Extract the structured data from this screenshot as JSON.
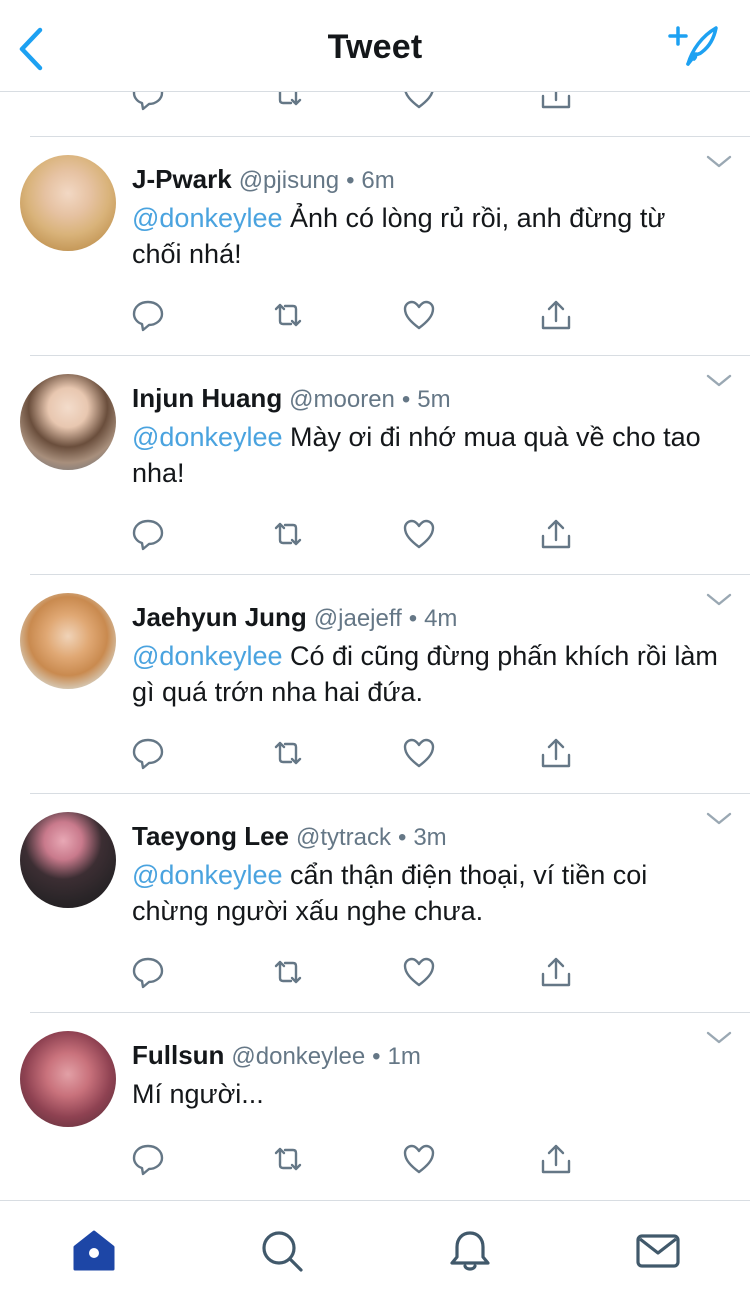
{
  "header": {
    "title": "Tweet"
  },
  "icons": {
    "back": "chevron-left-icon",
    "compose": "compose-sparkle-feather-icon",
    "reply": "reply-bubble-icon",
    "retweet": "retweet-icon",
    "like": "heart-icon",
    "share": "share-icon",
    "caret": "chevron-down-icon"
  },
  "colors": {
    "accent": "#1da1f2",
    "mention": "#4aa3df",
    "text": "#14171a",
    "muted": "#657786",
    "icon": "#657786",
    "tab_active": "#1d46a6",
    "tab_inactive": "#41596b"
  },
  "tweets": [
    {
      "name": "J-Pwark",
      "handle": "@pjisung",
      "time": "6m",
      "mention": "@donkeylee",
      "text": " Ảnh có lòng rủ rồi, anh đừng từ chối nhá!"
    },
    {
      "name": "Injun Huang",
      "handle": "@mooren",
      "time": "5m",
      "mention": "@donkeylee",
      "text": " Mày ơi đi nhớ mua quà về cho tao nha!"
    },
    {
      "name": "Jaehyun Jung",
      "handle": "@jaejeff",
      "time": "4m",
      "mention": "@donkeylee",
      "text": " Có đi cũng đừng phấn khích rồi làm gì quá trớn nha hai đứa."
    },
    {
      "name": "Taeyong Lee",
      "handle": "@tytrack",
      "time": "3m",
      "mention": "@donkeylee",
      "text": " cẩn thận điện thoại, ví tiền coi chừng người xấu nghe chưa."
    },
    {
      "name": "Fullsun",
      "handle": "@donkeylee",
      "time": "1m",
      "mention": "",
      "text": "Mí người..."
    }
  ],
  "separator": "•",
  "tabbar": {
    "items": [
      {
        "icon": "home-icon",
        "active": true
      },
      {
        "icon": "search-icon",
        "active": false
      },
      {
        "icon": "bell-icon",
        "active": false
      },
      {
        "icon": "mail-icon",
        "active": false
      }
    ]
  }
}
